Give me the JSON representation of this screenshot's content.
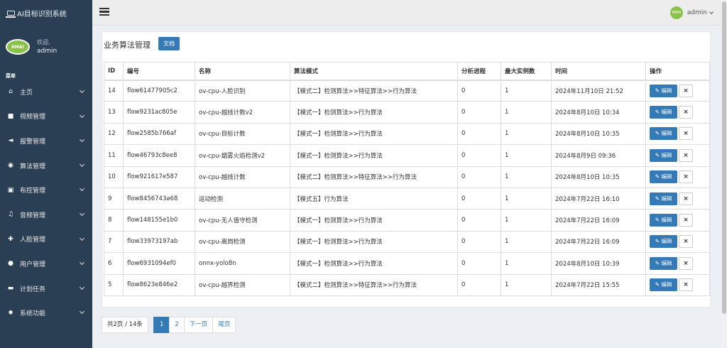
{
  "app": {
    "title": "AI目标识别系统"
  },
  "profile": {
    "avatar_text": "RMAI",
    "welcome": "欢迎,",
    "name": "admin"
  },
  "menu": {
    "heading": "菜单",
    "items": [
      {
        "label": "主页",
        "icon": "home-icon",
        "glyph": "⌂"
      },
      {
        "label": "视频管理",
        "icon": "video-camera-icon",
        "glyph": "■"
      },
      {
        "label": "报警管理",
        "icon": "bullhorn-icon",
        "glyph": "◄"
      },
      {
        "label": "算法管理",
        "icon": "eye-icon",
        "glyph": "◉"
      },
      {
        "label": "布控管理",
        "icon": "cube-icon",
        "glyph": "▣"
      },
      {
        "label": "音频管理",
        "icon": "music-icon",
        "glyph": "♫"
      },
      {
        "label": "人脸管理",
        "icon": "user-plus-icon",
        "glyph": "✚"
      },
      {
        "label": "用户管理",
        "icon": "user-icon",
        "glyph": "●"
      },
      {
        "label": "计划任务",
        "icon": "folder-open-icon",
        "glyph": "▬"
      },
      {
        "label": "系统功能",
        "icon": "gear-icon",
        "glyph": "✹"
      }
    ]
  },
  "topbar": {
    "user_avatar_text": "RMAI",
    "user_name": "admin"
  },
  "page": {
    "title": "业务算法管理",
    "doc_button": "文档"
  },
  "table": {
    "headers": [
      "ID",
      "编号",
      "名称",
      "算法模式",
      "分析进程",
      "最大实例数",
      "时间",
      "操作"
    ],
    "rows": [
      {
        "id": "14",
        "code": "flow61477905c2",
        "name": "ov-cpu-人脸识别",
        "mode": "【模式二】检测算法>>特征算法>>行为算法",
        "proc": "0",
        "max": "1",
        "time": "2024年11月10日 21:52"
      },
      {
        "id": "13",
        "code": "flow9231ac805e",
        "name": "ov-cpu-越线计数v2",
        "mode": "【模式一】检测算法>>行为算法",
        "proc": "0",
        "max": "1",
        "time": "2024年8月10日 10:34"
      },
      {
        "id": "12",
        "code": "flow2585b766af",
        "name": "ov-cpu-目标计数",
        "mode": "【模式一】检测算法>>行为算法",
        "proc": "0",
        "max": "1",
        "time": "2024年8月10日 10:35"
      },
      {
        "id": "11",
        "code": "flow46793c8ee8",
        "name": "ov-cpu-烟雾火焰检测v2",
        "mode": "【模式一】检测算法>>行为算法",
        "proc": "0",
        "max": "1",
        "time": "2024年8月9日 09:36"
      },
      {
        "id": "10",
        "code": "flow921617e587",
        "name": "ov-cpu-越线计数",
        "mode": "【模式二】检测算法>>特征算法>>行为算法",
        "proc": "0",
        "max": "1",
        "time": "2024年8月10日 10:35"
      },
      {
        "id": "9",
        "code": "flow8456743a68",
        "name": "运动检测",
        "mode": "【模式五】行为算法",
        "proc": "0",
        "max": "1",
        "time": "2024年7月22日 16:10"
      },
      {
        "id": "8",
        "code": "flow148155e1b0",
        "name": "ov-cpu-无人值守检测",
        "mode": "【模式一】检测算法>>行为算法",
        "proc": "0",
        "max": "1",
        "time": "2024年7月22日 16:09"
      },
      {
        "id": "7",
        "code": "flow33973197ab",
        "name": "ov-cpu-离岗检测",
        "mode": "【模式一】检测算法>>行为算法",
        "proc": "0",
        "max": "1",
        "time": "2024年7月22日 16:09"
      },
      {
        "id": "6",
        "code": "flow6931094ef0",
        "name": "onnx-yolo8n",
        "mode": "【模式一】检测算法>>行为算法",
        "proc": "0",
        "max": "1",
        "time": "2024年8月10日 10:39"
      },
      {
        "id": "5",
        "code": "flow8623e846e2",
        "name": "ov-cpu-越界检测",
        "mode": "【模式二】检测算法>>特征算法>>行为算法",
        "proc": "0",
        "max": "1",
        "time": "2024年7月22日 15:55"
      }
    ],
    "edit_label": "编辑",
    "delete_label": "×"
  },
  "pagination": {
    "info": "共2页 / 14条",
    "pages": [
      "1",
      "2"
    ],
    "current": "1",
    "next": "下一页",
    "last": "尾页"
  },
  "colors": {
    "sidebar": "#2a3f54",
    "primary": "#337ab7",
    "avatar": "#8bc34a"
  }
}
